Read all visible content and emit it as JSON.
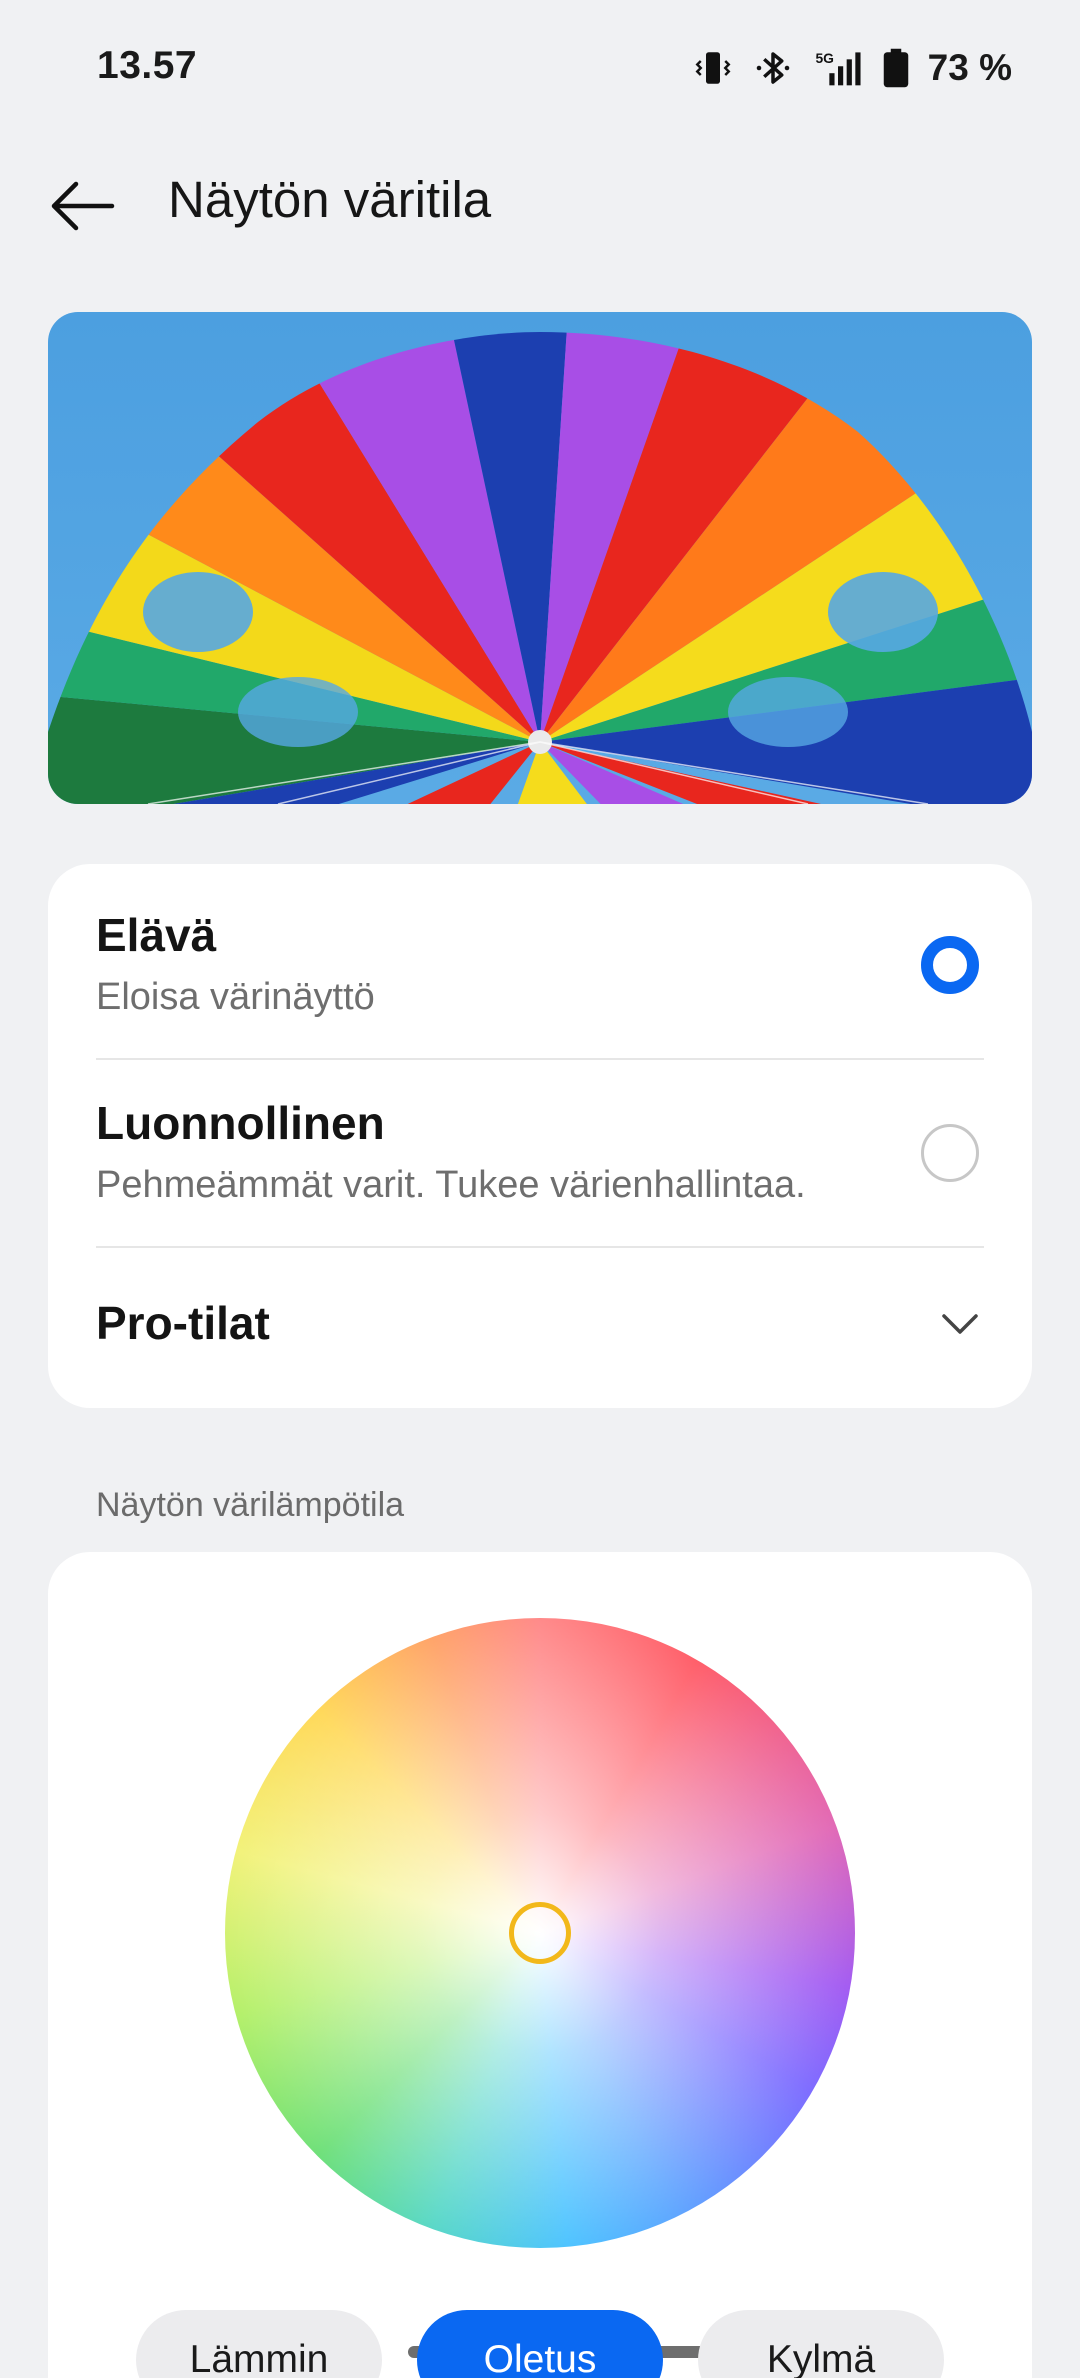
{
  "status_bar": {
    "time": "13.57",
    "network": "5G",
    "battery": "73 %",
    "icons": [
      "vibrate-icon",
      "bluetooth-icon",
      "signal-5g-icon",
      "battery-icon"
    ]
  },
  "header": {
    "title": "Näytön väritila",
    "back_icon": "arrow-left-icon"
  },
  "hero": {
    "image": "rainbow-parachute-photo"
  },
  "modes": {
    "options": [
      {
        "title": "Elävä",
        "subtitle": "Eloisa värinäyttö",
        "selected": true
      },
      {
        "title": "Luonnollinen",
        "subtitle": "Pehmeämmät varit. Tukee värienhallintaa.",
        "selected": false
      }
    ],
    "pro_label": "Pro-tilat",
    "pro_icon": "chevron-down-icon"
  },
  "temperature": {
    "heading": "Näytön värilämpötila",
    "presets": [
      {
        "label": "Lämmin",
        "active": false
      },
      {
        "label": "Oletus",
        "active": true
      },
      {
        "label": "Kylmä",
        "active": false
      }
    ]
  },
  "colors": {
    "accent": "#0a68f2",
    "background": "#f0f1f3",
    "card": "#ffffff",
    "handle": "#f2b81a"
  }
}
